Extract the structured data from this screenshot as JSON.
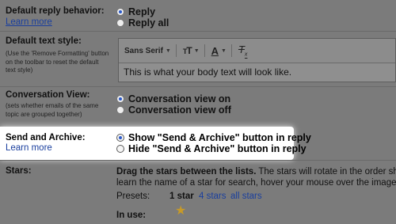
{
  "reply": {
    "label": "Default reply behavior:",
    "learn_more": "Learn more",
    "options": [
      "Reply",
      "Reply all"
    ],
    "selected": 0
  },
  "text_style": {
    "label": "Default text style:",
    "help": [
      "(Use the 'Remove Formatting' button",
      "on the toolbar to reset the default",
      "text style)"
    ],
    "toolbar": {
      "font": "Sans Serif",
      "size_icon": "text-size-icon",
      "color_icon": "text-color-icon",
      "clear_icon": "remove-formatting-icon"
    },
    "preview": "This is what your body text will look like."
  },
  "conversation": {
    "label": "Conversation View:",
    "help": [
      "(sets whether emails of the same",
      "topic are grouped together)"
    ],
    "options": [
      "Conversation view on",
      "Conversation view off"
    ],
    "selected": 0
  },
  "send_archive": {
    "label": "Send and Archive:",
    "learn_more": "Learn more",
    "options": [
      "Show \"Send & Archive\" button in reply",
      "Hide \"Send & Archive\" button in reply"
    ],
    "selected": 0
  },
  "stars": {
    "label": "Stars:",
    "instructions_bold": "Drag the stars between the lists.",
    "instructions_rest": "  The stars will rotate in the order shown",
    "instructions_line2": "learn the name of a star for search, hover your mouse over the image.",
    "presets_label": "Presets:",
    "presets": [
      "1 star",
      "4 stars",
      "all stars"
    ],
    "in_use_label": "In use:",
    "in_use_star_color": "#c79a28"
  },
  "colors": {
    "page_bg": "#7b7b7b",
    "link": "#1a3f9e",
    "radio_selected": "#2a59c9",
    "highlight_bg": "#ffffff"
  }
}
